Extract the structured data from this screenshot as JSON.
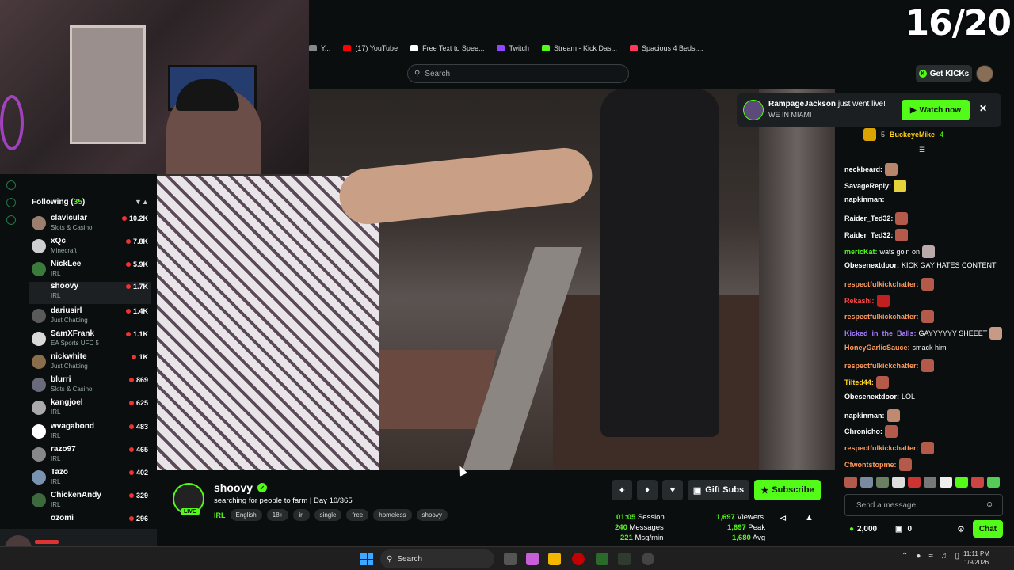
{
  "overlay": {
    "counter": "16/20"
  },
  "bookmarks": [
    {
      "label": "Y...",
      "color": "#888888"
    },
    {
      "label": "(17) YouTube",
      "color": "#ff0000"
    },
    {
      "label": "Free Text to Spee...",
      "color": "#ffffff"
    },
    {
      "label": "Twitch",
      "color": "#9146ff"
    },
    {
      "label": "Stream - Kick Das...",
      "color": "#53fc18"
    },
    {
      "label": "Spacious 4 Beds,...",
      "color": "#ff385c"
    }
  ],
  "header": {
    "search_placeholder": "Search",
    "get_kicks": "Get KICKs"
  },
  "following": {
    "title": "Following",
    "count": "35",
    "items": [
      {
        "name": "clavicular",
        "category": "Slots & Casino",
        "viewers": "10.2K"
      },
      {
        "name": "xQc",
        "category": "Minecraft",
        "viewers": "7.8K"
      },
      {
        "name": "NickLee",
        "category": "IRL",
        "viewers": "5.9K"
      },
      {
        "name": "shoovy",
        "category": "IRL",
        "viewers": "1.7K"
      },
      {
        "name": "dariusirl",
        "category": "Just Chatting",
        "viewers": "1.4K"
      },
      {
        "name": "SamXFrank",
        "category": "EA Sports UFC 5",
        "viewers": "1.1K"
      },
      {
        "name": "nickwhite",
        "category": "Just Chatting",
        "viewers": "1K"
      },
      {
        "name": "blurri",
        "category": "Slots & Casino",
        "viewers": "869"
      },
      {
        "name": "kangjoel",
        "category": "IRL",
        "viewers": "625"
      },
      {
        "name": "wvagabond",
        "category": "IRL",
        "viewers": "483"
      },
      {
        "name": "razo97",
        "category": "IRL",
        "viewers": "465"
      },
      {
        "name": "Tazo",
        "category": "IRL",
        "viewers": "402"
      },
      {
        "name": "ChickenAndy",
        "category": "IRL",
        "viewers": "329"
      },
      {
        "name": "ozomi",
        "category": "",
        "viewers": "296"
      }
    ]
  },
  "channel": {
    "name": "shoovy",
    "live_badge": "LIVE",
    "title": "searching for people to farm | Day 10/365",
    "category": "IRL",
    "tags": [
      "English",
      "18+",
      "irl",
      "single",
      "free",
      "homeless",
      "shoovy"
    ],
    "gift_subs": "Gift Subs",
    "subscribe": "Subscribe",
    "stats": {
      "session_value": "01:05",
      "session_label": "Session",
      "messages_value": "240",
      "messages_label": "Messages",
      "msgmin_value": "221",
      "msgmin_label": "Msg/min",
      "viewers_value": "1,697",
      "viewers_label": "Viewers",
      "peak_value": "1,697",
      "peak_label": "Peak",
      "avg_value": "1,680",
      "avg_label": "Avg"
    }
  },
  "toast": {
    "user": "RampageJackson",
    "text": "just went live!",
    "subtitle": "WE IN MIAMI",
    "button": "Watch now"
  },
  "chat": {
    "pinned_user": "BuckeyeMike",
    "pinned_count": "4",
    "pinned_left": "5",
    "messages": [
      {
        "user": "neckbeard:",
        "text": "",
        "color": "#ffffff",
        "emote": "#b8866a"
      },
      {
        "user": "SavageReply:",
        "text": "",
        "color": "#ffffff",
        "emote": "#e5d23a"
      },
      {
        "user": "napkinman:",
        "text": "",
        "color": "#ffffff",
        "emote": ""
      },
      {
        "user": "Raider_Ted32:",
        "text": "",
        "color": "#ffffff",
        "emote": "#b35a4a"
      },
      {
        "user": "Raider_Ted32:",
        "text": "",
        "color": "#ffffff",
        "emote": "#b35a4a"
      },
      {
        "user": "mericKat:",
        "text": "wats goin on",
        "color": "#53fc18",
        "emote": "#bbaaaa"
      },
      {
        "user": "Obesenextdoor:",
        "text": "KICK GAY HATES CONTENT",
        "color": "#ffffff",
        "emote": ""
      },
      {
        "user": "respectfulkickchatter:",
        "text": "",
        "color": "#ff9a5a",
        "emote": "#b35a4a"
      },
      {
        "user": "Rekashi:",
        "text": "",
        "color": "#ff4a4a",
        "emote": "#c02020"
      },
      {
        "user": "respectfulkickchatter:",
        "text": "",
        "color": "#ff9a5a",
        "emote": "#b35a4a"
      },
      {
        "user": "Kicked_in_the_Balls:",
        "text": "GAYYYYYY SHEEET",
        "color": "#a67cff",
        "emote": "#c79a85"
      },
      {
        "user": "HoneyGarlicSauce:",
        "text": "smack him",
        "color": "#ff9a5a",
        "emote": ""
      },
      {
        "user": "respectfulkickchatter:",
        "text": "",
        "color": "#ff9a5a",
        "emote": "#b35a4a"
      },
      {
        "user": "Tilted44:",
        "text": "",
        "color": "#ffd21a",
        "emote": "#b35a4a"
      },
      {
        "user": "Obesenextdoor:",
        "text": "LOL",
        "color": "#ffffff",
        "emote": ""
      },
      {
        "user": "napkinman:",
        "text": "",
        "color": "#ffffff",
        "emote": "#c08a70"
      },
      {
        "user": "Chronicho:",
        "text": "",
        "color": "#ffffff",
        "emote": "#b35a4a"
      },
      {
        "user": "respectfulkickchatter:",
        "text": "",
        "color": "#ff9a5a",
        "emote": "#b35a4a"
      },
      {
        "user": "Cfwontstopme:",
        "text": "",
        "color": "#ff9a5a",
        "emote": "#b35a4a"
      }
    ],
    "input_placeholder": "Send a message",
    "kicks": "2,000",
    "gifts": "0",
    "chat_button": "Chat"
  },
  "taskbar": {
    "search": "Search",
    "time": "11:11 PM",
    "date": "1/9/2026"
  }
}
